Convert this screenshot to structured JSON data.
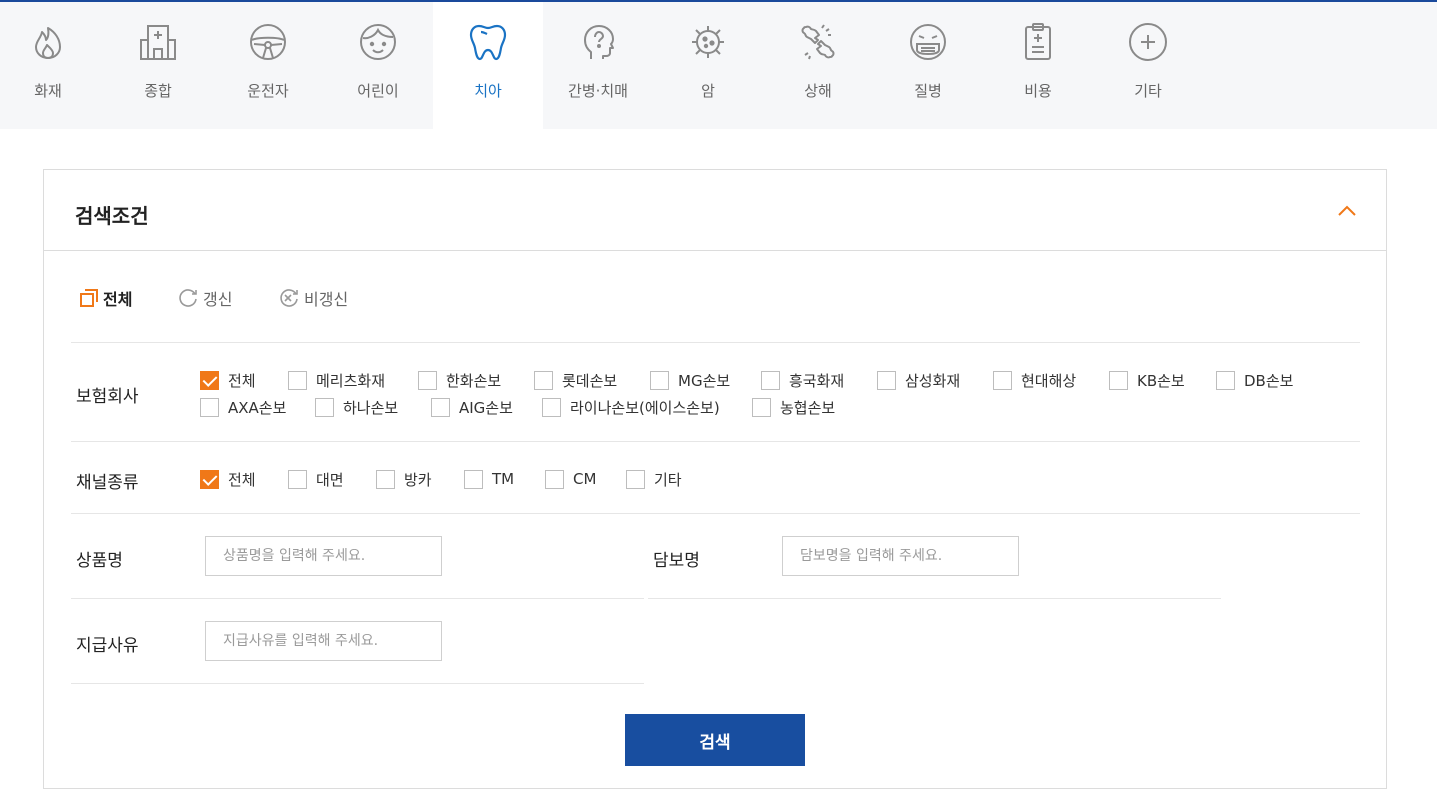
{
  "categories": [
    {
      "label": "화재",
      "icon": "fire-icon"
    },
    {
      "label": "종합",
      "icon": "hospital-icon"
    },
    {
      "label": "운전자",
      "icon": "steering-wheel-icon"
    },
    {
      "label": "어린이",
      "icon": "child-face-icon"
    },
    {
      "label": "치아",
      "icon": "tooth-icon",
      "active": true
    },
    {
      "label": "간병·치매",
      "icon": "head-question-icon"
    },
    {
      "label": "암",
      "icon": "virus-icon"
    },
    {
      "label": "상해",
      "icon": "broken-bone-icon"
    },
    {
      "label": "질병",
      "icon": "sick-mask-face-icon"
    },
    {
      "label": "비용",
      "icon": "clipboard-plus-icon"
    },
    {
      "label": "기타",
      "icon": "plus-circle-icon"
    }
  ],
  "panel": {
    "title": "검색조건",
    "renewal": [
      {
        "label": "전체",
        "icon": "square-stack-icon",
        "active": true
      },
      {
        "label": "갱신",
        "icon": "refresh-icon",
        "active": false
      },
      {
        "label": "비갱신",
        "icon": "cancel-circle-icon",
        "active": false
      }
    ],
    "insurers": {
      "label": "보험회사",
      "options": [
        {
          "label": "전체",
          "checked": true
        },
        {
          "label": "메리츠화재",
          "checked": false
        },
        {
          "label": "한화손보",
          "checked": false
        },
        {
          "label": "롯데손보",
          "checked": false
        },
        {
          "label": "MG손보",
          "checked": false
        },
        {
          "label": "흥국화재",
          "checked": false
        },
        {
          "label": "삼성화재",
          "checked": false
        },
        {
          "label": "현대해상",
          "checked": false
        },
        {
          "label": "KB손보",
          "checked": false
        },
        {
          "label": "DB손보",
          "checked": false
        },
        {
          "label": "AXA손보",
          "checked": false
        },
        {
          "label": "하나손보",
          "checked": false
        },
        {
          "label": "AIG손보",
          "checked": false
        },
        {
          "label": "라이나손보(에이스손보)",
          "checked": false
        },
        {
          "label": "농협손보",
          "checked": false
        }
      ]
    },
    "channels": {
      "label": "채널종류",
      "options": [
        {
          "label": "전체",
          "checked": true
        },
        {
          "label": "대면",
          "checked": false
        },
        {
          "label": "방카",
          "checked": false
        },
        {
          "label": "TM",
          "checked": false
        },
        {
          "label": "CM",
          "checked": false
        },
        {
          "label": "기타",
          "checked": false
        }
      ]
    },
    "product": {
      "label": "상품명",
      "value": "",
      "placeholder": "상품명을 입력해 주세요."
    },
    "coverage": {
      "label": "담보명",
      "value": "",
      "placeholder": "담보명을 입력해 주세요."
    },
    "reason": {
      "label": "지급사유",
      "value": "",
      "placeholder": "지급사유를 입력해 주세요."
    },
    "search_label": "검색"
  },
  "colors": {
    "accent": "#f07818",
    "primary": "#184ea0",
    "active_tab": "#1a73c4"
  }
}
